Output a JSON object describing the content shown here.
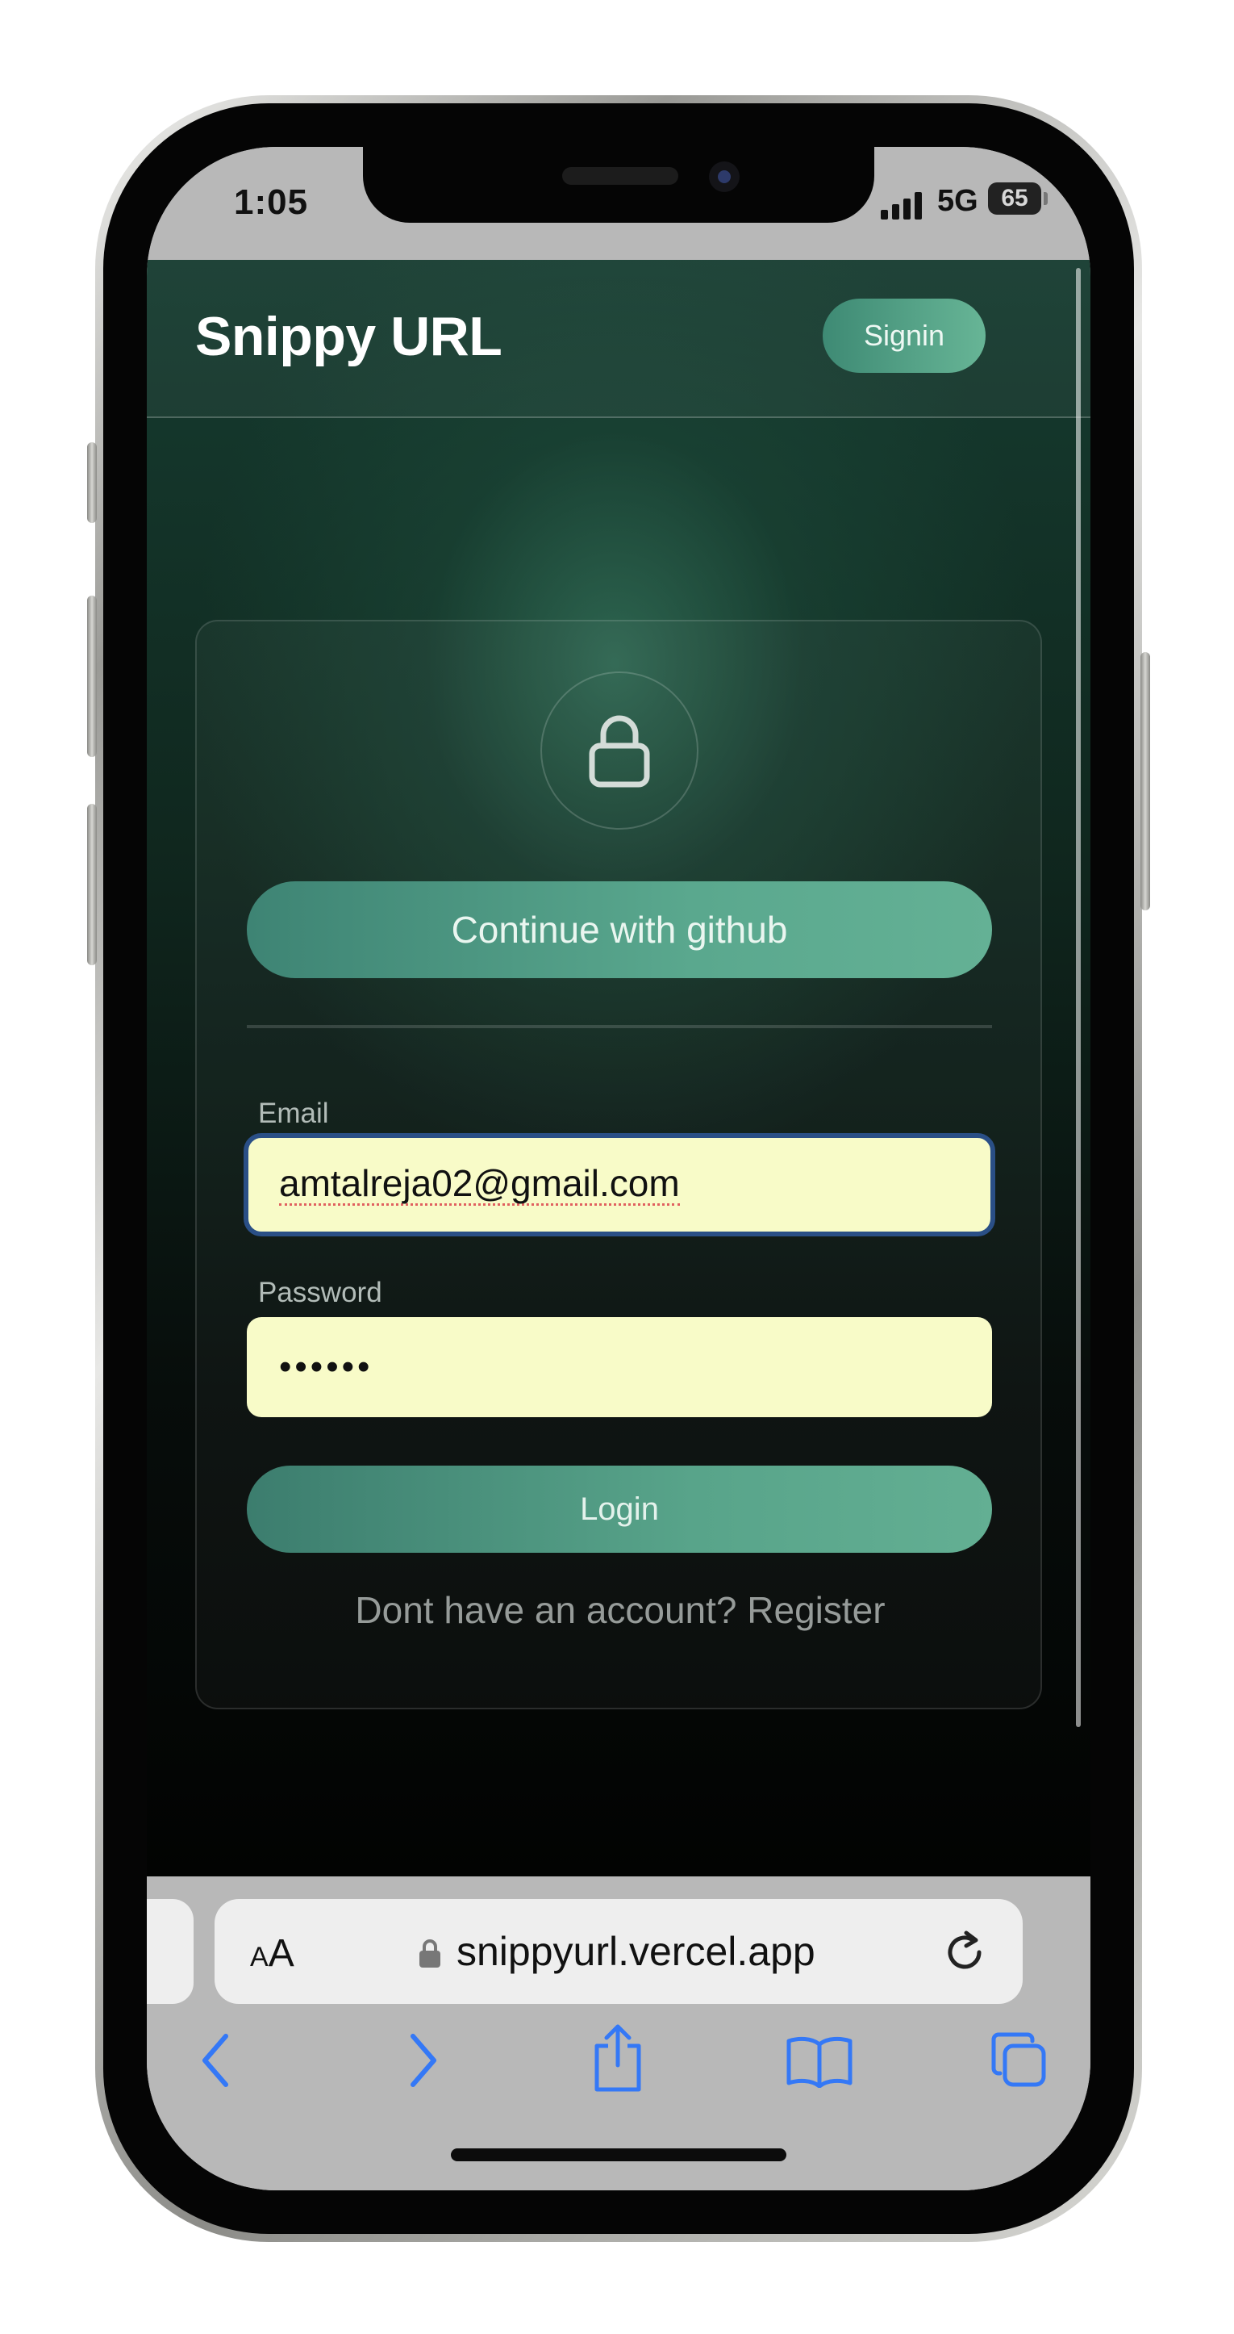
{
  "status_bar": {
    "time": "1:05",
    "network": "5G",
    "battery": "65"
  },
  "site": {
    "brand": "Snippy URL",
    "signin_label": "Signin"
  },
  "login_card": {
    "github_button": "Continue with github",
    "email_label": "Email",
    "email_value": "amtalreja02@gmail.com",
    "password_label": "Password",
    "password_value": "••••••",
    "login_button": "Login",
    "register_prompt": "Dont have an account?",
    "register_link": "Register"
  },
  "safari": {
    "text_size_small": "A",
    "text_size_big": "A",
    "url": "snippyurl.vercel.app"
  },
  "icons": {
    "lock": "lock-icon",
    "back": "chevron-left-icon",
    "forward": "chevron-right-icon",
    "share": "share-icon",
    "bookmarks": "book-icon",
    "tabs": "tabs-icon",
    "reload": "reload-icon"
  },
  "colors": {
    "accent": "#5aa88e",
    "input_fill": "#f8fbc8",
    "focus_border": "#2a4f86",
    "safari_blue": "#3478f6"
  }
}
